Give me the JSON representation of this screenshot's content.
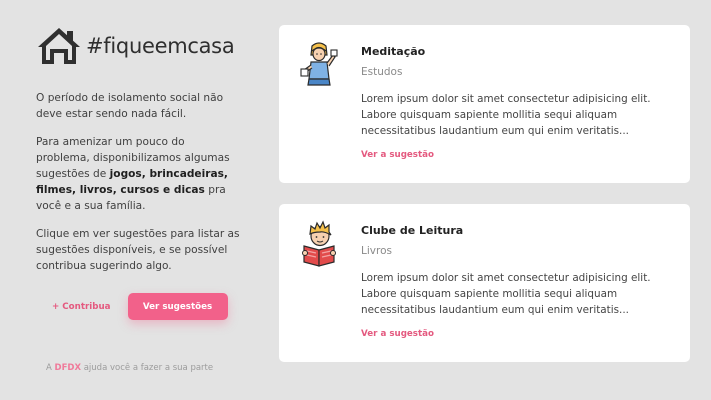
{
  "brand": {
    "title": "#fiqueemcasa",
    "icon": "house-icon"
  },
  "intro": {
    "p1": "O período de isolamento social não deve estar sendo nada fácil.",
    "p2_before": "Para amenizar um pouco do problema, disponibilizamos algumas sugestões de ",
    "p2_bold": "jogos, brincadeiras, filmes, livros, cursos e dicas",
    "p2_after": " pra você e a sua família.",
    "p3": "Clique em ver sugestões para listar as sugestões disponíveis, e se possível contribua sugerindo algo."
  },
  "actions": {
    "contribute_label": "+ Contribua",
    "view_label": "Ver sugestões"
  },
  "footer": {
    "prefix": "A ",
    "brand": "DFDX",
    "suffix": " ajuda você a fazer a sua parte"
  },
  "cards": [
    {
      "icon": "meditation-person-icon",
      "title": "Meditação",
      "category": "Estudos",
      "text": "Lorem ipsum dolor sit amet consectetur adipisicing elit. Labore quisquam sapiente mollitia sequi aliquam necessitatibus laudantium eum qui enim veritatis...",
      "link": "Ver a sugestão"
    },
    {
      "icon": "reading-boy-icon",
      "title": "Clube de Leitura",
      "category": "Livros",
      "text": "Lorem ipsum dolor sit amet consectetur adipisicing elit. Labore quisquam sapiente mollitia sequi aliquam necessitatibus laudantium eum qui enim veritatis...",
      "link": "Ver a sugestão"
    }
  ],
  "colors": {
    "background": "#e3e3e3",
    "accent": "#f2618a",
    "accent_text": "#e4597f",
    "card": "#ffffff"
  }
}
